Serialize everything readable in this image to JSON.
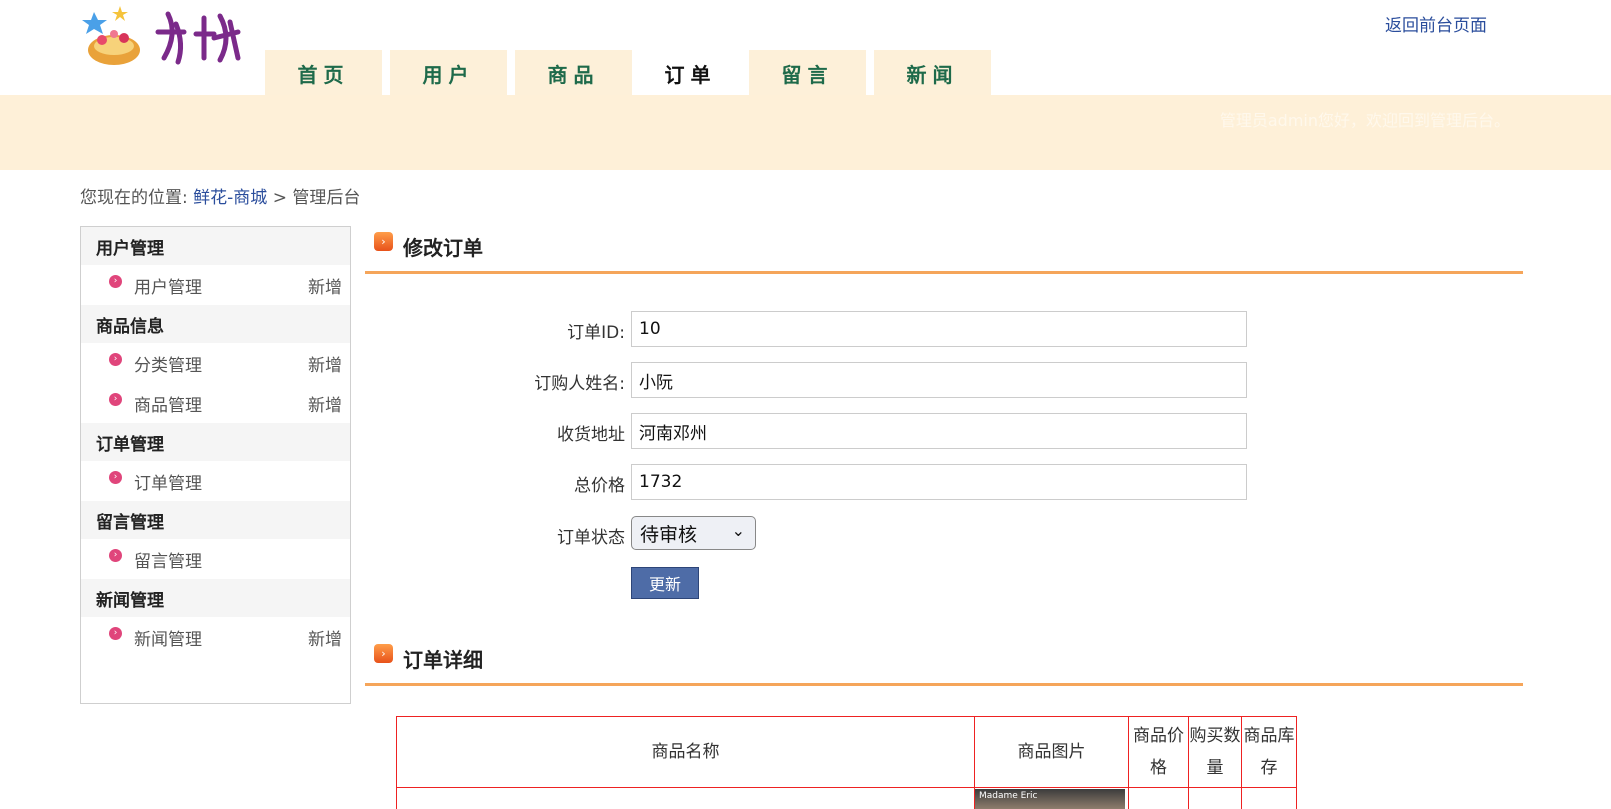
{
  "header": {
    "back_link": "返回前台页面",
    "welcome": "管理员admin您好，欢迎回到管理后台。"
  },
  "nav": {
    "tabs": [
      {
        "label": "首页"
      },
      {
        "label": "用户"
      },
      {
        "label": "商品"
      },
      {
        "label": "订单",
        "active": true
      },
      {
        "label": "留言"
      },
      {
        "label": "新闻"
      }
    ]
  },
  "breadcrumb": {
    "prefix": "您现在的位置:",
    "site": "鲜花-商城",
    "sep": ">",
    "current": "管理后台"
  },
  "sidebar": {
    "add_label": "新增",
    "groups": [
      {
        "title": "用户管理",
        "items": [
          {
            "label": "用户管理",
            "add": true
          }
        ]
      },
      {
        "title": "商品信息",
        "items": [
          {
            "label": "分类管理",
            "add": true
          },
          {
            "label": "商品管理",
            "add": true
          }
        ]
      },
      {
        "title": "订单管理",
        "items": [
          {
            "label": "订单管理",
            "add": false
          }
        ]
      },
      {
        "title": "留言管理",
        "items": [
          {
            "label": "留言管理",
            "add": false
          }
        ]
      },
      {
        "title": "新闻管理",
        "items": [
          {
            "label": "新闻管理",
            "add": true
          }
        ]
      }
    ]
  },
  "edit_section": {
    "title": "修改订单",
    "fields": {
      "order_id": {
        "label": "订单ID:",
        "value": "10"
      },
      "buyer": {
        "label": "订购人姓名:",
        "value": "小阮"
      },
      "address": {
        "label": "收货地址",
        "value": "河南邓州"
      },
      "total": {
        "label": "总价格",
        "value": "1732"
      },
      "status": {
        "label": "订单状态",
        "value": "待审核"
      }
    },
    "submit_label": "更新"
  },
  "detail_section": {
    "title": "订单详细",
    "columns": [
      "商品名称",
      "商品图片",
      "商品价格",
      "购买数量",
      "商品库存"
    ],
    "thumb_caption": "Madame Eric"
  }
}
